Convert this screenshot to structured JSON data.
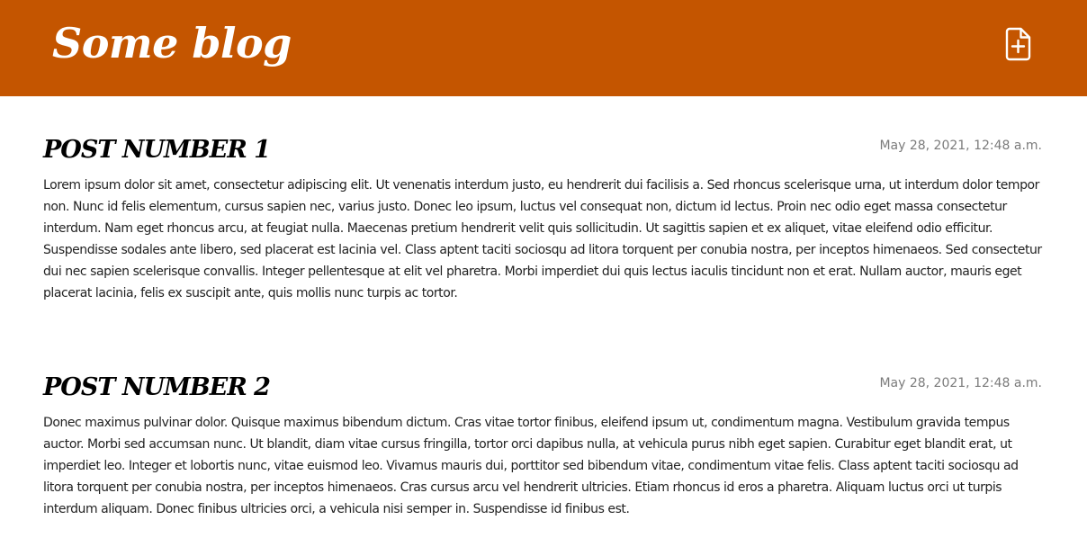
{
  "header": {
    "brand": "Some blog",
    "new_post_icon": "file-plus-icon",
    "background_color": "#c45500"
  },
  "posts": [
    {
      "title": "Post number 1",
      "date": "May 28, 2021, 12:48 a.m.",
      "body": "Lorem ipsum dolor sit amet, consectetur adipiscing elit. Ut venenatis interdum justo, eu hendrerit dui facilisis a. Sed rhoncus scelerisque urna, ut interdum dolor tempor non. Nunc id felis elementum, cursus sapien nec, varius justo. Donec leo ipsum, luctus vel consequat non, dictum id lectus. Proin nec odio eget massa consectetur interdum. Nam eget rhoncus arcu, at feugiat nulla. Maecenas pretium hendrerit velit quis sollicitudin. Ut sagittis sapien et ex aliquet, vitae eleifend odio efficitur. Suspendisse sodales ante libero, sed placerat est lacinia vel. Class aptent taciti sociosqu ad litora torquent per conubia nostra, per inceptos himenaeos. Sed consectetur dui nec sapien scelerisque convallis. Integer pellentesque at elit vel pharetra. Morbi imperdiet dui quis lectus iaculis tincidunt non et erat. Nullam auctor, mauris eget placerat lacinia, felis ex suscipit ante, quis mollis nunc turpis ac tortor."
    },
    {
      "title": "Post number 2",
      "date": "May 28, 2021, 12:48 a.m.",
      "body": "Donec maximus pulvinar dolor. Quisque maximus bibendum dictum. Cras vitae tortor finibus, eleifend ipsum ut, condimentum magna. Vestibulum gravida tempus auctor. Morbi sed accumsan nunc. Ut blandit, diam vitae cursus fringilla, tortor orci dapibus nulla, at vehicula purus nibh eget sapien. Curabitur eget blandit erat, ut imperdiet leo. Integer et lobortis nunc, vitae euismod leo. Vivamus mauris dui, porttitor sed bibendum vitae, condimentum vitae felis. Class aptent taciti sociosqu ad litora torquent per conubia nostra, per inceptos himenaeos. Cras cursus arcu vel hendrerit ultricies. Etiam rhoncus id eros a pharetra. Aliquam luctus orci ut turpis interdum aliquam. Donec finibus ultricies orci, a vehicula nisi semper in. Suspendisse id finibus est."
    }
  ]
}
